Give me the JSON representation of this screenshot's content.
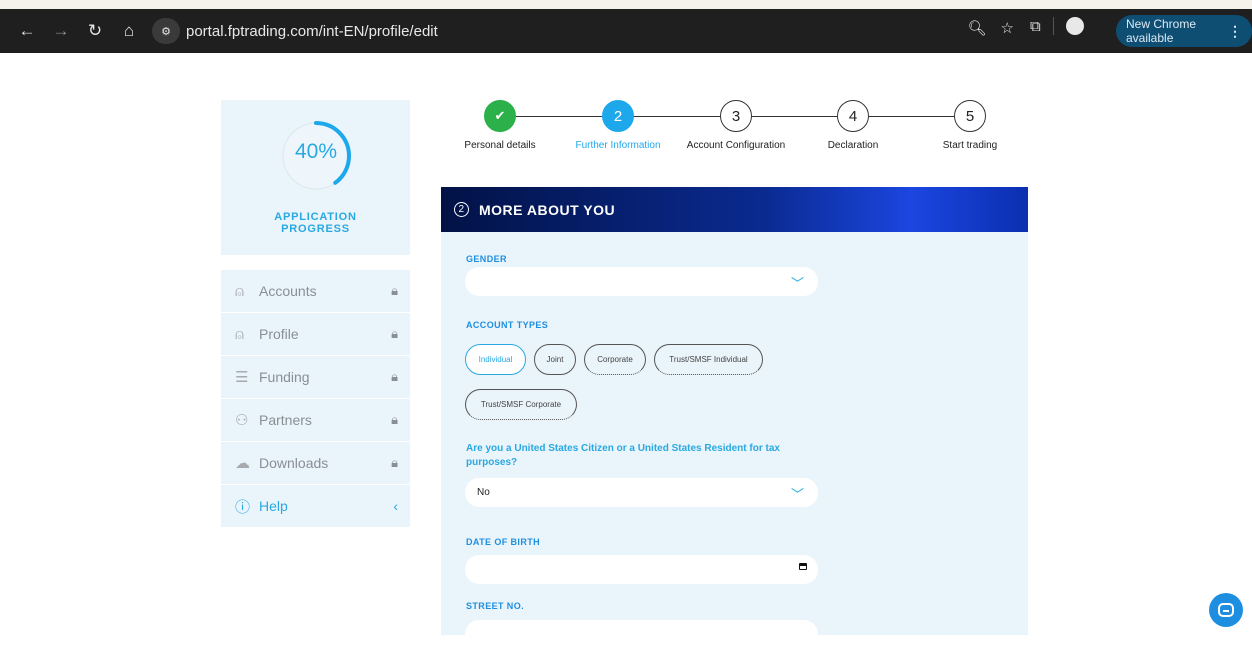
{
  "browser": {
    "url": "portal.fptrading.com/int-EN/profile/edit",
    "new_chrome": "New Chrome available"
  },
  "progress": {
    "percent_text": "40%",
    "percent_value": 0.4,
    "label_line1": "APPLICATION",
    "label_line2": "PROGRESS"
  },
  "sidebar": {
    "items": [
      {
        "label": "Accounts",
        "icon": "user-icon"
      },
      {
        "label": "Profile",
        "icon": "user-plus-icon"
      },
      {
        "label": "Funding",
        "icon": "wallet-icon"
      },
      {
        "label": "Partners",
        "icon": "users-icon"
      },
      {
        "label": "Downloads",
        "icon": "cloud-download-icon"
      }
    ],
    "help": "Help"
  },
  "steps": [
    {
      "num": "",
      "label": "Personal details",
      "state": "done"
    },
    {
      "num": "2",
      "label": "Further Information",
      "state": "active"
    },
    {
      "num": "3",
      "label": "Account Configuration",
      "state": "todo"
    },
    {
      "num": "4",
      "label": "Declaration",
      "state": "todo"
    },
    {
      "num": "5",
      "label": "Start trading",
      "state": "todo"
    }
  ],
  "form": {
    "section_num": "2",
    "section_title": "MORE ABOUT YOU",
    "gender_label": "GENDER",
    "gender_value": "",
    "account_types_label": "ACCOUNT TYPES",
    "account_types": [
      "Individual",
      "Joint",
      "Corporate",
      "Trust/SMSF Individual",
      "Trust/SMSF Corporate"
    ],
    "us_question": "Are you a United States Citizen or a United States Resident for tax purposes?",
    "us_value": "No",
    "dob_label": "DATE OF BIRTH",
    "street_label": "STREET NO."
  },
  "colors": {
    "accent": "#29a9e1",
    "done_green": "#2bb04a",
    "panel_bg": "#eaf4fb",
    "header_navy": "#021246"
  }
}
